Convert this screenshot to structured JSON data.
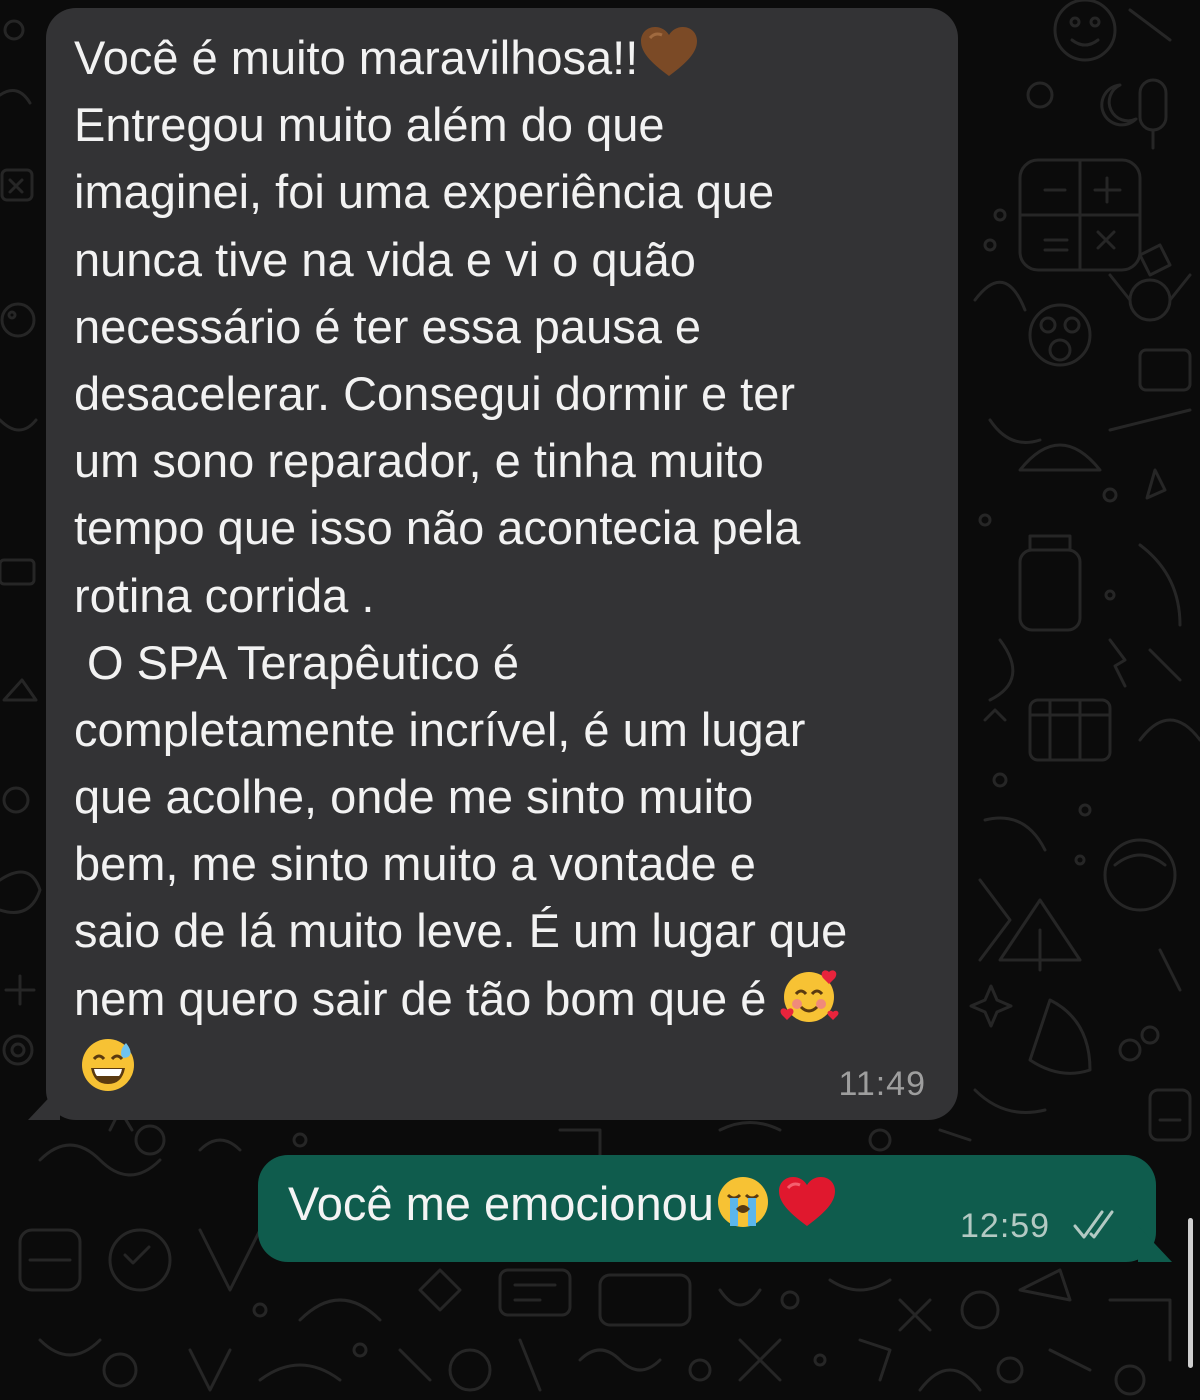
{
  "chat": {
    "incoming_message": {
      "lines": [
        "Você é muito maravilhosa!!",
        "Entregou muito além do que",
        "imaginei, foi uma experiência que",
        "nunca tive na vida e vi o quão",
        "necessário é ter essa pausa e",
        "desacelerar. Consegui dormir e ter",
        "um sono reparador, e tinha muito",
        "tempo que isso não acontecia pela",
        "rotina corrida .",
        " O SPA Terapêutico é",
        "completamente incrível, é um lugar",
        "que acolhe, onde me sinto muito",
        "bem, me sinto muito a vontade e",
        "saio de lá muito leve. É um lugar que",
        "nem quero sair de tão bom que é"
      ],
      "emojis": [
        "brown-heart",
        "smiling-face-with-hearts",
        "grinning-face-with-sweat"
      ],
      "time": "11:49"
    },
    "outgoing_message": {
      "text": "Você me emocionou",
      "emojis": [
        "loudly-crying-face",
        "red-heart"
      ],
      "time": "12:59",
      "status": "read-double-check"
    }
  },
  "colors": {
    "background": "#0b0b0b",
    "incoming_bubble": "#333335",
    "outgoing_bubble": "#0f5c4d",
    "text": "#f2f2f2",
    "timestamp_in": "#9e9e9e",
    "timestamp_out": "#b3c9c3"
  }
}
